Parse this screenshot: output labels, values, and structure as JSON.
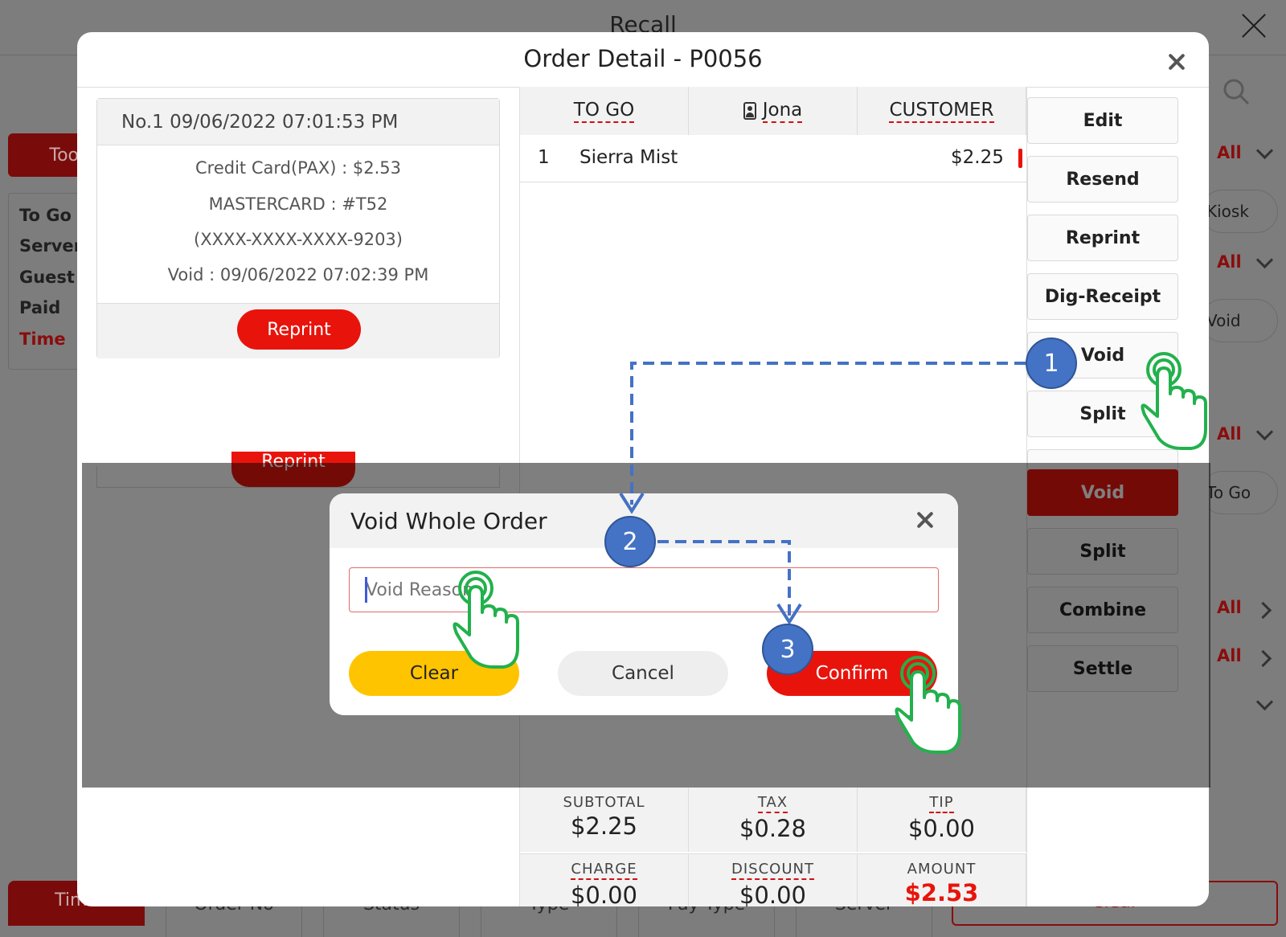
{
  "background": {
    "title": "Recall",
    "left_tab": "Too",
    "info_labels": [
      "To Go",
      "Server",
      "Guest",
      "Paid",
      "Time"
    ],
    "filter_all": "All",
    "pills": [
      "Kiosk",
      "Void",
      "To Go"
    ],
    "bottom_tabs": [
      "Time",
      "Order No",
      "Status",
      "Type",
      "Pay Type",
      "Server"
    ],
    "bottom_clear": "Clear",
    "behind_reprint": "Reprint"
  },
  "modal": {
    "title": "Order Detail - P0056",
    "payment": {
      "header": "No.1  09/06/2022 07:01:53 PM",
      "lines": [
        "Credit Card(PAX) : $2.53",
        "MASTERCARD : #T52",
        "(XXXX-XXXX-XXXX-9203)",
        "Void : 09/06/2022 07:02:39 PM"
      ],
      "reprint_label": "Reprint"
    },
    "order_header": {
      "type": "TO GO",
      "server": "Jona",
      "customer": "CUSTOMER"
    },
    "items": [
      {
        "qty": "1",
        "name": "Sierra Mist",
        "price": "$2.25"
      }
    ],
    "side_buttons": [
      "Edit",
      "Resend",
      "Reprint",
      "Dig-Receipt",
      "Void",
      "Split"
    ],
    "side_buttons_lower": [
      "Void",
      "Split",
      "Combine",
      "Settle"
    ],
    "totals": {
      "subtotal_label": "SUBTOTAL",
      "subtotal": "$2.25",
      "tax_label": "TAX",
      "tax": "$0.28",
      "tip_label": "TIP",
      "tip": "$0.00",
      "charge_label": "CHARGE",
      "charge": "$0.00",
      "discount_label": "DISCOUNT",
      "discount": "$0.00",
      "amount_label": "AMOUNT",
      "amount": "$2.53"
    }
  },
  "void_dialog": {
    "title": "Void Whole Order",
    "reason_placeholder": "Void Reason",
    "clear_label": "Clear",
    "cancel_label": "Cancel",
    "confirm_label": "Confirm"
  },
  "annotations": {
    "steps": [
      "1",
      "2",
      "3"
    ]
  },
  "colors": {
    "accent_red": "#e8140c",
    "dark_red": "#8a0d0d",
    "yellow": "#ffc400",
    "step_blue": "#4472c4",
    "tap_green": "#22b14c"
  }
}
